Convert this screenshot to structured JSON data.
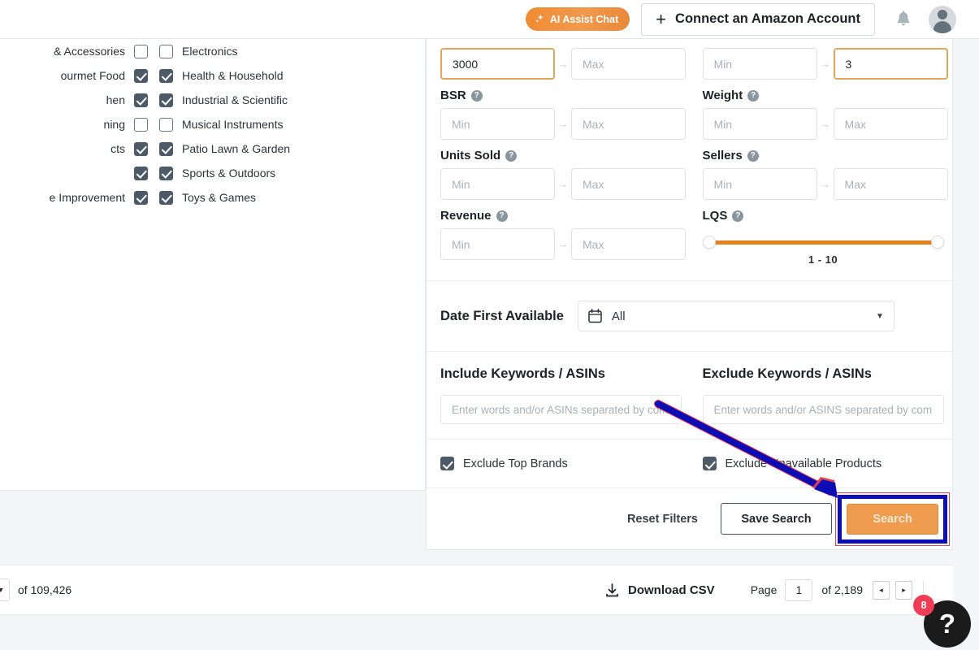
{
  "topbar": {
    "ai_chat_label": "AI Assist Chat",
    "connect_label": "Connect an Amazon Account",
    "plus": "+",
    "bell_icon": "bell-icon",
    "avatar_icon": "user-avatar-icon"
  },
  "categories": {
    "left_column": [
      {
        "label": "& Accessories",
        "checked": false,
        "truncated": true
      },
      {
        "label": "ourmet Food",
        "checked": true,
        "truncated": true
      },
      {
        "label": "hen",
        "checked": true,
        "truncated": true
      },
      {
        "label": "ning",
        "checked": false,
        "truncated": true
      },
      {
        "label": "cts",
        "checked": true,
        "truncated": true
      },
      {
        "label": "",
        "checked": true,
        "truncated": true
      },
      {
        "label": "e Improvement",
        "checked": true,
        "truncated": true
      }
    ],
    "right_column": [
      {
        "label": "Electronics",
        "checked": false
      },
      {
        "label": "Health & Household",
        "checked": true
      },
      {
        "label": "Industrial & Scientific",
        "checked": true
      },
      {
        "label": "Musical Instruments",
        "checked": false
      },
      {
        "label": "Patio Lawn & Garden",
        "checked": true
      },
      {
        "label": "Sports & Outdoors",
        "checked": true
      },
      {
        "label": "Toys & Games",
        "checked": true
      }
    ]
  },
  "filters": {
    "top_row": {
      "left_min_value": "3000",
      "left_max_placeholder": "Max",
      "right_min_placeholder": "Min",
      "right_max_value": "3"
    },
    "bsr": {
      "label": "BSR",
      "min_placeholder": "Min",
      "max_placeholder": "Max"
    },
    "weight": {
      "label": "Weight",
      "min_placeholder": "Min",
      "max_placeholder": "Max"
    },
    "units_sold": {
      "label": "Units Sold",
      "min_placeholder": "Min",
      "max_placeholder": "Max"
    },
    "sellers": {
      "label": "Sellers",
      "min_placeholder": "Min",
      "max_placeholder": "Max"
    },
    "revenue": {
      "label": "Revenue",
      "min_placeholder": "Min",
      "max_placeholder": "Max"
    },
    "lqs": {
      "label": "LQS",
      "range_text": "1  -  10",
      "min": 1,
      "max": 10
    },
    "date_first_available": {
      "label": "Date First Available",
      "value": "All",
      "calendar_icon": "calendar-icon"
    },
    "include_keywords": {
      "title": "Include Keywords / ASINs",
      "placeholder": "Enter words and/or ASINs separated by commas"
    },
    "exclude_keywords": {
      "title": "Exclude Keywords / ASINs",
      "placeholder": "Enter words and/or ASINS separated by commas"
    },
    "exclude_top_brands": {
      "label": "Exclude Top Brands",
      "checked": true
    },
    "exclude_unavailable": {
      "label": "Exclude Unavailable Products",
      "checked": true
    },
    "actions": {
      "reset_label": "Reset Filters",
      "save_label": "Save Search",
      "search_label": "Search"
    },
    "help_tooltip_glyph": "?"
  },
  "footer": {
    "of_total": "of 109,426",
    "download_csv": "Download CSV",
    "page_label": "Page",
    "page_value": "1",
    "page_of": "of 2,189",
    "prev_glyph": "◂",
    "next_glyph": "▸",
    "help_glyph": "?",
    "help_badge": "8"
  },
  "colors": {
    "accent_orange": "#ef9c4f",
    "slider_orange": "#e3821d",
    "checkbox_slate": "#4c5b67",
    "annotation_blue": "#0d0db5",
    "annotation_red": "#e8414f",
    "badge_red": "#ef3d55"
  }
}
